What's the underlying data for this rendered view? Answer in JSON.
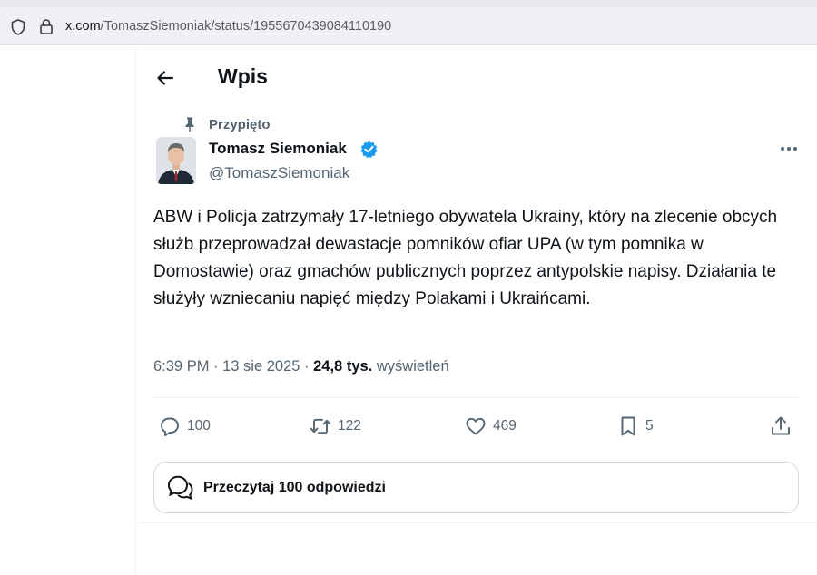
{
  "browser": {
    "url_host": "x.com",
    "url_path": "/TomaszSiemoniak/status/1955670439084110190"
  },
  "header": {
    "title": "Wpis"
  },
  "tweet": {
    "pinned_label": "Przypięto",
    "author_name": "Tomasz Siemoniak",
    "author_handle": "@TomaszSiemoniak",
    "text": "ABW i Policja zatrzymały 17-letniego obywatela Ukrainy, który na zlecenie obcych służb przeprowadzał dewastacje pomników ofiar UPA (w tym pomnika w Domostawie) oraz gmachów publicznych poprzez antypolskie napisy. Działania te służyły wzniecaniu napięć między Polakami i Ukraińcami.",
    "time": "6:39 PM",
    "date": "13 sie 2025",
    "views_count": "24,8 tys.",
    "views_label": "wyświetleń",
    "stats": {
      "replies": "100",
      "retweets": "122",
      "likes": "469",
      "bookmarks": "5"
    },
    "read_replies_label": "Przeczytaj 100 odpowiedzi"
  },
  "colors": {
    "verified_badge": "#1d9bf0",
    "text_primary": "#0f1419",
    "text_secondary": "#536471"
  },
  "icons": {
    "back": "arrow-left-icon",
    "pin": "pin-icon",
    "verified": "verified-badge-icon",
    "more": "more-dots-icon",
    "reply": "reply-icon",
    "retweet": "retweet-icon",
    "like": "heart-icon",
    "bookmark": "bookmark-icon",
    "share": "share-icon",
    "replies": "speech-bubbles-icon"
  }
}
